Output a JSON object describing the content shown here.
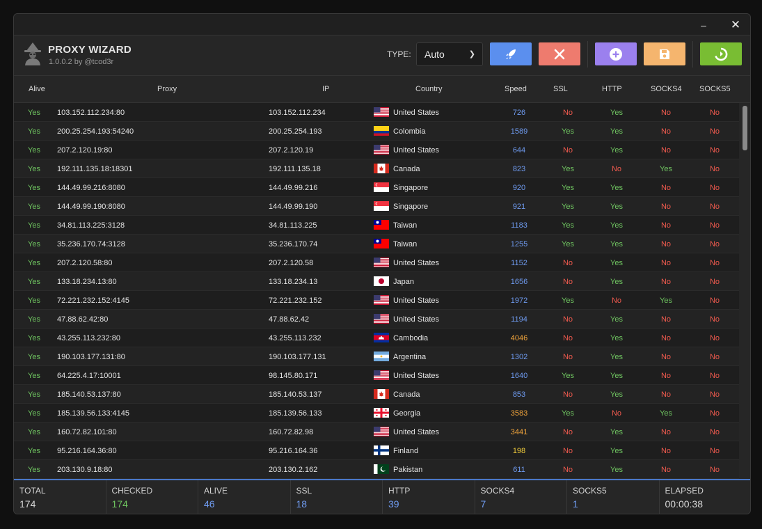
{
  "window": {
    "minimize_glyph": "–",
    "close_glyph": "✕"
  },
  "app": {
    "title": "PROXY WIZARD",
    "version": "1.0.0.2 by @tcod3r",
    "logo_icon": "wizard-icon"
  },
  "toolbar": {
    "type_label": "TYPE:",
    "type_value": "Auto",
    "buttons": [
      {
        "name": "start",
        "icon": "rocket-icon",
        "color": "#5b8fee"
      },
      {
        "name": "stop",
        "icon": "x-icon",
        "color": "#ee7b6e"
      },
      {
        "name": "add",
        "icon": "plus-circle-icon",
        "color": "#9b80ee"
      },
      {
        "name": "save",
        "icon": "floppy-icon",
        "color": "#f5b56e"
      },
      {
        "name": "refresh",
        "icon": "refresh-icon",
        "color": "#79bd33"
      }
    ]
  },
  "columns": {
    "alive": "Alive",
    "proxy": "Proxy",
    "ip": "IP",
    "country": "Country",
    "speed": "Speed",
    "ssl": "SSL",
    "http": "HTTP",
    "socks4": "SOCKS4",
    "socks5": "SOCKS5"
  },
  "rows": [
    {
      "alive": "Yes",
      "proxy": "103.152.112.234:80",
      "ip": "103.152.112.234",
      "flag": "US",
      "country": "United States",
      "speed": "726",
      "ssl": "No",
      "http": "Yes",
      "socks4": "No",
      "socks5": "No"
    },
    {
      "alive": "Yes",
      "proxy": "200.25.254.193:54240",
      "ip": "200.25.254.193",
      "flag": "CO",
      "country": "Colombia",
      "speed": "1589",
      "ssl": "Yes",
      "http": "Yes",
      "socks4": "No",
      "socks5": "No"
    },
    {
      "alive": "Yes",
      "proxy": "207.2.120.19:80",
      "ip": "207.2.120.19",
      "flag": "US",
      "country": "United States",
      "speed": "644",
      "ssl": "No",
      "http": "Yes",
      "socks4": "No",
      "socks5": "No"
    },
    {
      "alive": "Yes",
      "proxy": "192.111.135.18:18301",
      "ip": "192.111.135.18",
      "flag": "CA",
      "country": "Canada",
      "speed": "823",
      "ssl": "Yes",
      "http": "No",
      "socks4": "Yes",
      "socks5": "No"
    },
    {
      "alive": "Yes",
      "proxy": "144.49.99.216:8080",
      "ip": "144.49.99.216",
      "flag": "SG",
      "country": "Singapore",
      "speed": "920",
      "ssl": "Yes",
      "http": "Yes",
      "socks4": "No",
      "socks5": "No"
    },
    {
      "alive": "Yes",
      "proxy": "144.49.99.190:8080",
      "ip": "144.49.99.190",
      "flag": "SG",
      "country": "Singapore",
      "speed": "921",
      "ssl": "Yes",
      "http": "Yes",
      "socks4": "No",
      "socks5": "No"
    },
    {
      "alive": "Yes",
      "proxy": "34.81.113.225:3128",
      "ip": "34.81.113.225",
      "flag": "TW",
      "country": "Taiwan",
      "speed": "1183",
      "ssl": "Yes",
      "http": "Yes",
      "socks4": "No",
      "socks5": "No"
    },
    {
      "alive": "Yes",
      "proxy": "35.236.170.74:3128",
      "ip": "35.236.170.74",
      "flag": "TW",
      "country": "Taiwan",
      "speed": "1255",
      "ssl": "Yes",
      "http": "Yes",
      "socks4": "No",
      "socks5": "No"
    },
    {
      "alive": "Yes",
      "proxy": "207.2.120.58:80",
      "ip": "207.2.120.58",
      "flag": "US",
      "country": "United States",
      "speed": "1152",
      "ssl": "No",
      "http": "Yes",
      "socks4": "No",
      "socks5": "No"
    },
    {
      "alive": "Yes",
      "proxy": "133.18.234.13:80",
      "ip": "133.18.234.13",
      "flag": "JP",
      "country": "Japan",
      "speed": "1656",
      "ssl": "No",
      "http": "Yes",
      "socks4": "No",
      "socks5": "No"
    },
    {
      "alive": "Yes",
      "proxy": "72.221.232.152:4145",
      "ip": "72.221.232.152",
      "flag": "US",
      "country": "United States",
      "speed": "1972",
      "ssl": "Yes",
      "http": "No",
      "socks4": "Yes",
      "socks5": "No"
    },
    {
      "alive": "Yes",
      "proxy": "47.88.62.42:80",
      "ip": "47.88.62.42",
      "flag": "US",
      "country": "United States",
      "speed": "1194",
      "ssl": "No",
      "http": "Yes",
      "socks4": "No",
      "socks5": "No"
    },
    {
      "alive": "Yes",
      "proxy": "43.255.113.232:80",
      "ip": "43.255.113.232",
      "flag": "KH",
      "country": "Cambodia",
      "speed": "4046",
      "ssl": "No",
      "http": "Yes",
      "socks4": "No",
      "socks5": "No"
    },
    {
      "alive": "Yes",
      "proxy": "190.103.177.131:80",
      "ip": "190.103.177.131",
      "flag": "AR",
      "country": "Argentina",
      "speed": "1302",
      "ssl": "No",
      "http": "Yes",
      "socks4": "No",
      "socks5": "No"
    },
    {
      "alive": "Yes",
      "proxy": "64.225.4.17:10001",
      "ip": "98.145.80.171",
      "flag": "US",
      "country": "United States",
      "speed": "1640",
      "ssl": "Yes",
      "http": "Yes",
      "socks4": "No",
      "socks5": "No"
    },
    {
      "alive": "Yes",
      "proxy": "185.140.53.137:80",
      "ip": "185.140.53.137",
      "flag": "CA",
      "country": "Canada",
      "speed": "853",
      "ssl": "No",
      "http": "Yes",
      "socks4": "No",
      "socks5": "No"
    },
    {
      "alive": "Yes",
      "proxy": "185.139.56.133:4145",
      "ip": "185.139.56.133",
      "flag": "GE",
      "country": "Georgia",
      "speed": "3583",
      "ssl": "Yes",
      "http": "No",
      "socks4": "Yes",
      "socks5": "No"
    },
    {
      "alive": "Yes",
      "proxy": "160.72.82.101:80",
      "ip": "160.72.82.98",
      "flag": "US",
      "country": "United States",
      "speed": "3441",
      "ssl": "No",
      "http": "Yes",
      "socks4": "No",
      "socks5": "No"
    },
    {
      "alive": "Yes",
      "proxy": "95.216.164.36:80",
      "ip": "95.216.164.36",
      "flag": "FI",
      "country": "Finland",
      "speed": "198",
      "ssl": "No",
      "http": "Yes",
      "socks4": "No",
      "socks5": "No"
    },
    {
      "alive": "Yes",
      "proxy": "203.130.9.18:80",
      "ip": "203.130.2.162",
      "flag": "PK",
      "country": "Pakistan",
      "speed": "611",
      "ssl": "No",
      "http": "Yes",
      "socks4": "No",
      "socks5": "No"
    }
  ],
  "stats": [
    {
      "label": "TOTAL",
      "value": "174",
      "color": "white"
    },
    {
      "label": "CHECKED",
      "value": "174",
      "color": "green"
    },
    {
      "label": "ALIVE",
      "value": "46",
      "color": "blue"
    },
    {
      "label": "SSL",
      "value": "18",
      "color": "blue"
    },
    {
      "label": "HTTP",
      "value": "39",
      "color": "blue"
    },
    {
      "label": "SOCKS4",
      "value": "7",
      "color": "blue"
    },
    {
      "label": "SOCKS5",
      "value": "1",
      "color": "blue"
    },
    {
      "label": "ELAPSED",
      "value": "00:00:38",
      "color": "white"
    }
  ]
}
